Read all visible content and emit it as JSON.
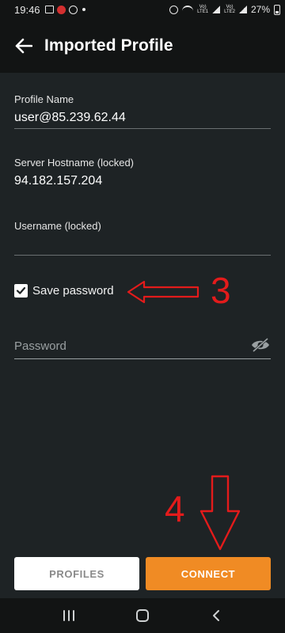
{
  "status_bar": {
    "time": "19:46",
    "battery": "27%",
    "network_label": "Vo) LTE1 LTE2"
  },
  "header": {
    "title": "Imported Profile",
    "back_icon": "arrow-left-icon"
  },
  "form": {
    "profile_name": {
      "label": "Profile Name",
      "value": "user@85.239.62.44"
    },
    "server_hostname": {
      "label": "Server Hostname (locked)",
      "value": "94.182.157.204"
    },
    "username": {
      "label": "Username (locked)",
      "value": ""
    },
    "save_password": {
      "label": "Save password",
      "checked": true
    },
    "password": {
      "placeholder": "Password",
      "value": "",
      "visibility_icon": "eye-off-icon"
    }
  },
  "annotations": {
    "step3": "3",
    "step4": "4",
    "color": "#e31b1b"
  },
  "buttons": {
    "profiles": "PROFILES",
    "connect": "CONNECT"
  },
  "colors": {
    "accent": "#f08b24",
    "background": "#1e2325",
    "bar": "#121414"
  },
  "nav": {
    "recent": "recent-apps-icon",
    "home": "home-icon",
    "back": "back-icon"
  }
}
